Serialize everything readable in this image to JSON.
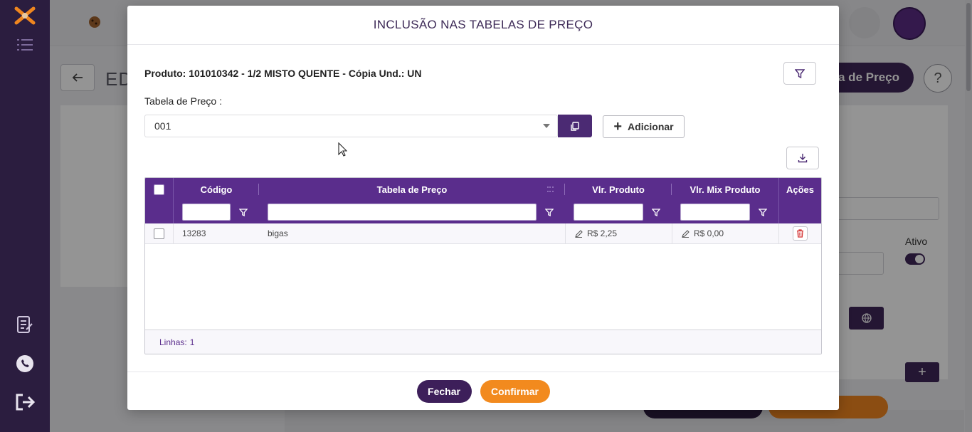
{
  "background": {
    "page_title": "ED",
    "header_button_label": "ela de Preço",
    "help_label": "?",
    "ativo_label": "Ativo",
    "partial_label": "e"
  },
  "modal": {
    "title": "INCLUSÃO NAS TABELAS DE PREÇO",
    "product_label": "Produto: 101010342 - 1/2 MISTO QUENTE - Cópia Und.: UN",
    "price_table_label": "Tabela de Preço :",
    "price_table_value": "001",
    "add_button_label": "Adicionar",
    "grid": {
      "columns": [
        "Código",
        "Tabela de Preço",
        "Vlr. Produto",
        "Vlr. Mix Produto",
        "Ações"
      ],
      "rows": [
        {
          "codigo": "13283",
          "tabela": "bigas",
          "vlr_produto": "R$ 2,25",
          "vlr_mix": "R$ 0,00"
        }
      ],
      "footer_label": "Linhas:",
      "footer_count": "1"
    },
    "close_label": "Fechar",
    "confirm_label": "Confirmar"
  },
  "colors": {
    "brand_purple": "#5a2d8c",
    "dark_purple": "#3d1f5a",
    "accent_orange": "#f28a1e"
  }
}
